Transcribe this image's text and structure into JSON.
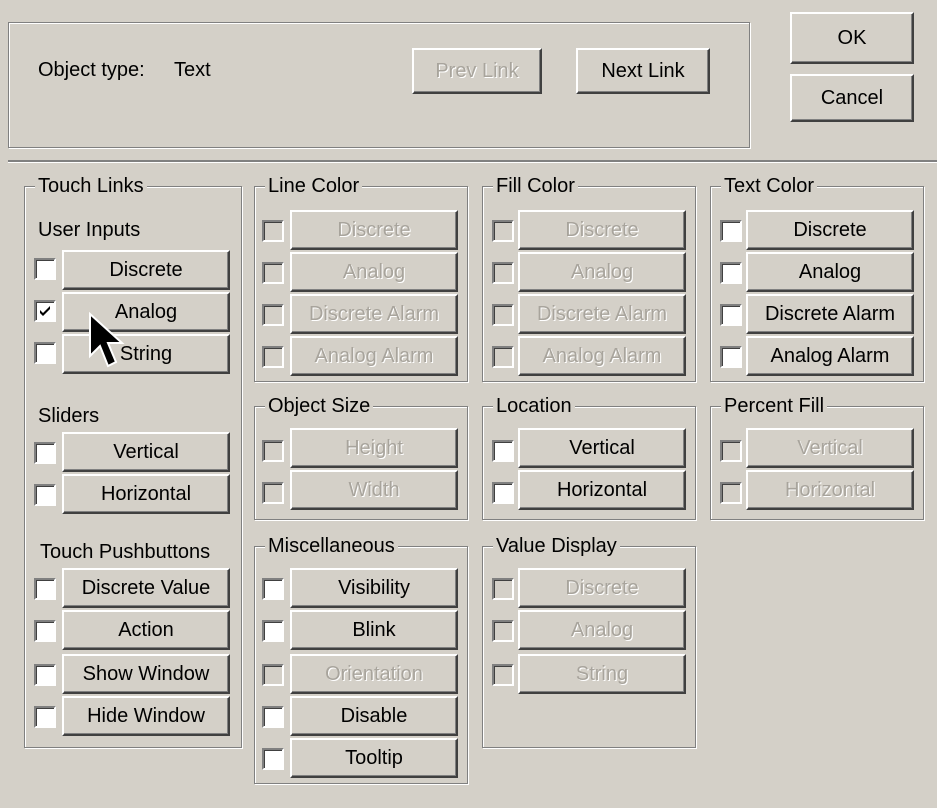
{
  "header": {
    "object_type_label": "Object type:",
    "object_type_value": "Text",
    "prev_link": "Prev Link",
    "next_link": "Next Link",
    "ok": "OK",
    "cancel": "Cancel"
  },
  "touch_links": {
    "title": "Touch Links",
    "user_inputs_label": "User Inputs",
    "user_inputs": [
      {
        "label": "Discrete",
        "checked": false
      },
      {
        "label": "Analog",
        "checked": true
      },
      {
        "label": "String",
        "checked": false
      }
    ],
    "sliders_label": "Sliders",
    "sliders": [
      {
        "label": "Vertical",
        "checked": false
      },
      {
        "label": "Horizontal",
        "checked": false
      }
    ],
    "pushbuttons_label": "Touch Pushbuttons",
    "pushbuttons": [
      {
        "label": "Discrete Value",
        "checked": false
      },
      {
        "label": "Action",
        "checked": false
      },
      {
        "label": "Show Window",
        "checked": false
      },
      {
        "label": "Hide Window",
        "checked": false
      }
    ]
  },
  "line_color": {
    "title": "Line Color",
    "items": [
      "Discrete",
      "Analog",
      "Discrete Alarm",
      "Analog Alarm"
    ]
  },
  "fill_color": {
    "title": "Fill Color",
    "items": [
      "Discrete",
      "Analog",
      "Discrete Alarm",
      "Analog Alarm"
    ]
  },
  "text_color": {
    "title": "Text Color",
    "items": [
      "Discrete",
      "Analog",
      "Discrete Alarm",
      "Analog Alarm"
    ]
  },
  "object_size": {
    "title": "Object Size",
    "items": [
      "Height",
      "Width"
    ]
  },
  "location": {
    "title": "Location",
    "items": [
      "Vertical",
      "Horizontal"
    ]
  },
  "percent_fill": {
    "title": "Percent Fill",
    "items": [
      "Vertical",
      "Horizontal"
    ]
  },
  "misc": {
    "title": "Miscellaneous",
    "items": [
      "Visibility",
      "Blink",
      "Orientation",
      "Disable",
      "Tooltip"
    ]
  },
  "value_display": {
    "title": "Value Display",
    "items": [
      "Discrete",
      "Analog",
      "String"
    ]
  }
}
